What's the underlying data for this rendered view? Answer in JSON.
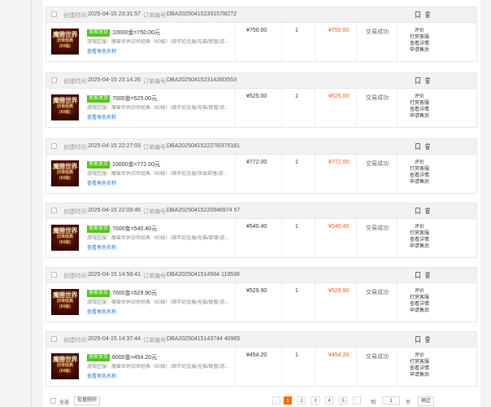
{
  "labels": {
    "created_time": "创建时间:",
    "order_no": "订单编号:"
  },
  "orders": [
    {
      "created": "2025-04-15 23:31:57",
      "order_no": "DBA202504152331571 8272",
      "order_no_full": "DBA20250415233157l8272",
      "thumb": {
        "line1": "魔兽世界",
        "line2": "旧世经典",
        "line3": "(60级)"
      },
      "badge": "卖家发货",
      "title": "10000金=750.00元",
      "info": "游戏区服：魔兽世界旧世经典（60级）/周年纪念服/无猫/联盟/游...",
      "link": "查看角色名称",
      "price": "¥750.00",
      "qty": "1",
      "paid": "¥750.00",
      "status": "交易成功",
      "actions": [
        "评价",
        "打赏客服",
        "查看详情",
        "申请售后"
      ]
    },
    {
      "created": "2025-04-15 23:14:26",
      "order_no_full": "DBA20250415231426l3553",
      "thumb": {
        "line1": "魔兽世界",
        "line2": "旧世经典",
        "line3": "(60级)"
      },
      "badge": "卖家发货",
      "title": "7000金=525.00元",
      "info": "游戏区服：魔兽世界旧世经典（60级）/周年纪念服/无猫/联盟/游...",
      "link": "查看角色名称",
      "price": "¥525.00",
      "qty": "1",
      "paid": "¥525.00",
      "status": "交易成功",
      "actions": [
        "评价",
        "打赏客服",
        "查看详情",
        "申请售后"
      ]
    },
    {
      "created": "2025-04-15 22:27:03",
      "order_no_full": "DBA202504152227l0375181",
      "thumb": {
        "line1": "魔兽世界",
        "line2": "旧世经典",
        "line3": "(60级)"
      },
      "badge": "卖家发货",
      "title": "10000金=772.00元",
      "info": "游戏区服：魔兽世界旧世经典（60级）/周年纪念服/铁血部落/游...",
      "link": "查看角色名称",
      "price": "¥772.00",
      "qty": "1",
      "paid": "¥772.00",
      "status": "交易成功",
      "actions": [
        "评价",
        "打赏客服",
        "查看详情",
        "申请售后"
      ]
    },
    {
      "created": "2025-04-15 22:09:46",
      "order_no_full": "DBA20250415220946974 57",
      "thumb": {
        "line1": "魔兽世界",
        "line2": "旧世经典",
        "line3": "(60级)"
      },
      "badge": "卖家发货",
      "title": "7000金=540.40元",
      "info": "游戏区服：魔兽世界旧世经典（60级）/周年纪念服/无猫/部落/游...",
      "link": "查看角色名称",
      "price": "¥540.40",
      "qty": "1",
      "paid": "¥540.40",
      "status": "交易成功",
      "actions": [
        "评价",
        "打赏客服",
        "查看详情",
        "申请售后"
      ]
    },
    {
      "created": "2025-04-15 14:58:41",
      "order_no_full": "DBA2025041514584 119539",
      "thumb": {
        "line1": "魔兽世界",
        "line2": "旧世经典",
        "line3": "(60级)"
      },
      "badge": "卖家发货",
      "title": "7000金=529.90元",
      "info": "游戏区服：魔兽世界旧世经典（60级）/周年纪念服/无猫/联盟/游...",
      "link": "查看角色名称",
      "price": "¥529.90",
      "qty": "1",
      "paid": "¥529.90",
      "status": "交易成功",
      "actions": [
        "评价",
        "打赏客服",
        "查看详情",
        "申请售后"
      ]
    },
    {
      "created": "2025-04-15 14:37:44",
      "order_no_full": "DBA20250415143744 40965",
      "thumb": {
        "line1": "魔兽世界",
        "line2": "旧世经典",
        "line3": "(60级)"
      },
      "badge": "卖家发货",
      "title": "6000金=454.20元",
      "info": "游戏区服：魔兽世界旧世经典（60级）/周年纪念服/无猫/联盟/游...",
      "link": "查看角色名称",
      "price": "¥454.20",
      "qty": "1",
      "paid": "¥454.20",
      "status": "交易成功",
      "actions": [
        "评价",
        "打赏客服",
        "查看详情",
        "申请售后"
      ]
    }
  ],
  "footer": {
    "select_all": "全选",
    "batch_delete": "批量删除",
    "prev": "‹",
    "pages": [
      "1",
      "2",
      "3",
      "4",
      "5"
    ],
    "current_page": "1",
    "next": "›",
    "goto_label": "到",
    "goto_value": "1",
    "page_unit": "页",
    "ok": "确定"
  },
  "colors": {
    "accent": "#ff6a00",
    "badge": "#52c41a",
    "link": "#1e78d7",
    "paid": "#ff5a1f"
  }
}
